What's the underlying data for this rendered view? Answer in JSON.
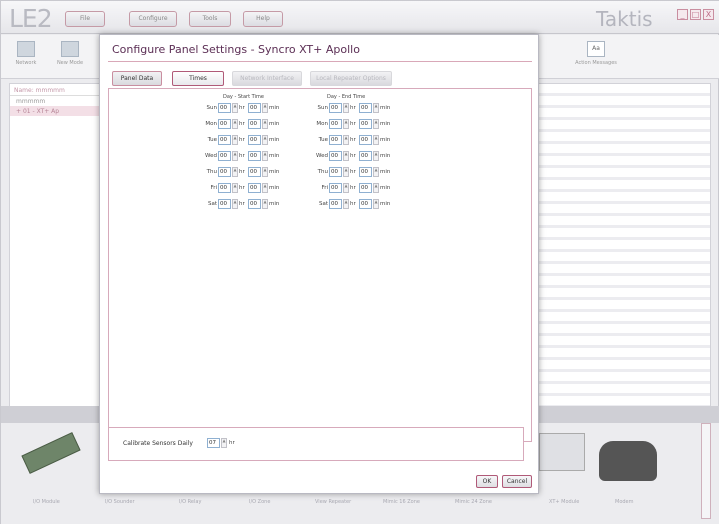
{
  "app": {
    "logo": "LE2",
    "brand": "Taktis",
    "menu": [
      "File",
      "Configure",
      "Tools",
      "Help"
    ],
    "window_controls": [
      "_",
      "□",
      "X"
    ]
  },
  "toolbar": {
    "items": [
      "Network",
      "New Mode",
      "Action Messages"
    ],
    "aa_label": "Aa"
  },
  "left_panel": {
    "header": "Name: mmmmm",
    "rows": [
      "mmmmm",
      "01 - XT+ Ap"
    ]
  },
  "bottom_palette": {
    "items": [
      "I/O Module",
      "I/O Sounder",
      "I/O Relay",
      "I/O Zone",
      "View Repeater",
      "Mimic 16 Zone",
      "Mimic 24 Zone",
      "XT+ Module",
      "Modem"
    ]
  },
  "dialog": {
    "title": "Configure Panel Settings - Syncro XT+ Apollo",
    "tabs": [
      "Panel Data",
      "Times",
      "Network Interface",
      "Local Repeater Options"
    ],
    "start_header": "Day - Start Time",
    "end_header": "Day - End Time",
    "days": [
      "Sun",
      "Mon",
      "Tue",
      "Wed",
      "Thu",
      "Fri",
      "Sat"
    ],
    "start_hour": "00",
    "start_min": "00",
    "end_hour": "00",
    "end_min": "00",
    "hr_unit": "hr",
    "min_unit": "min",
    "calibrate_label": "Calibrate Sensors Daily",
    "calibrate_value": "07",
    "calibrate_unit": "hr",
    "ok": "OK",
    "cancel": "Cancel"
  },
  "icons": {
    "spin_up": "▲",
    "spin_down": "▼",
    "tree_expand": "+"
  }
}
